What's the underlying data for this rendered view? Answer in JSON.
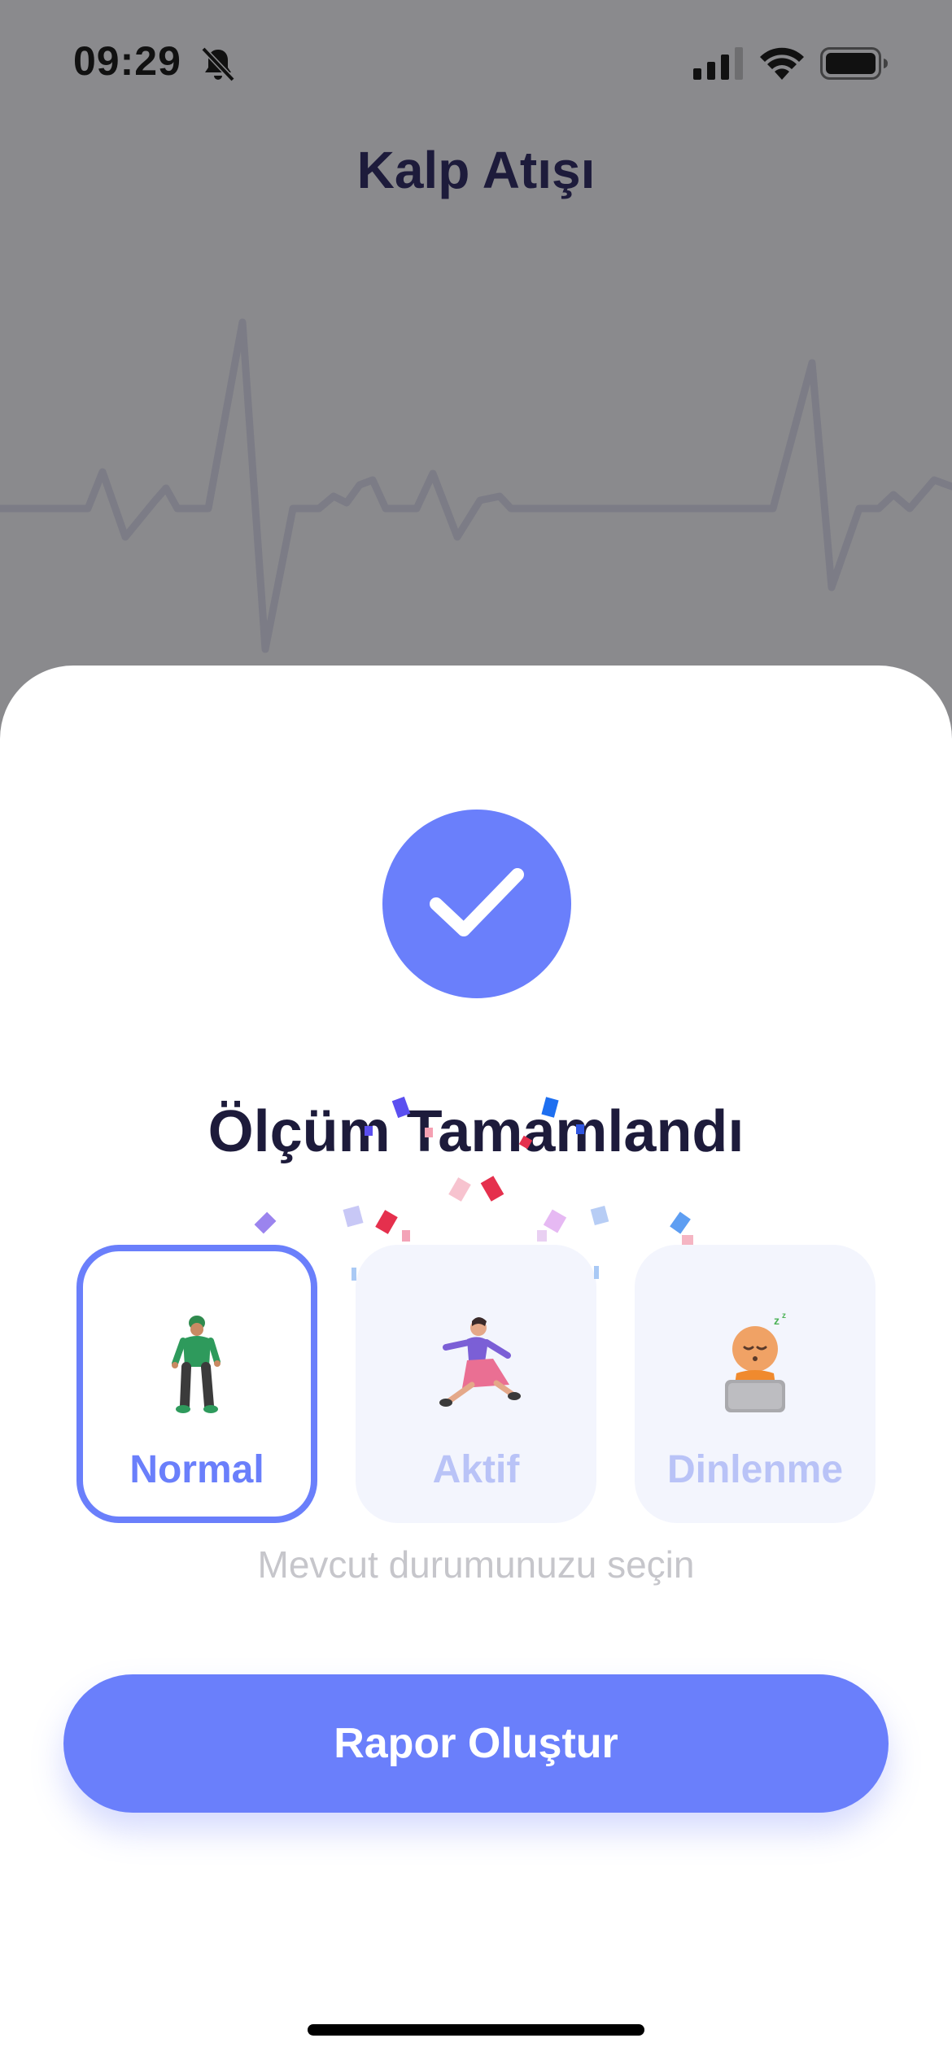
{
  "status_bar": {
    "time": "09:29"
  },
  "header": {
    "title": "Kalp Atışı"
  },
  "sheet": {
    "title": "Ölçüm Tamamlandı",
    "options": [
      {
        "label": "Normal",
        "selected": true,
        "icon": "standing-person-icon"
      },
      {
        "label": "Aktif",
        "selected": false,
        "icon": "running-person-icon"
      },
      {
        "label": "Dinlenme",
        "selected": false,
        "icon": "sleeping-person-icon"
      }
    ],
    "hint": "Mevcut durumunuzu seçin",
    "cta_label": "Rapor Oluştur"
  },
  "colors": {
    "accent": "#6a7ffb",
    "title": "#1d1b3b",
    "overlay": "#8a8a8d"
  }
}
